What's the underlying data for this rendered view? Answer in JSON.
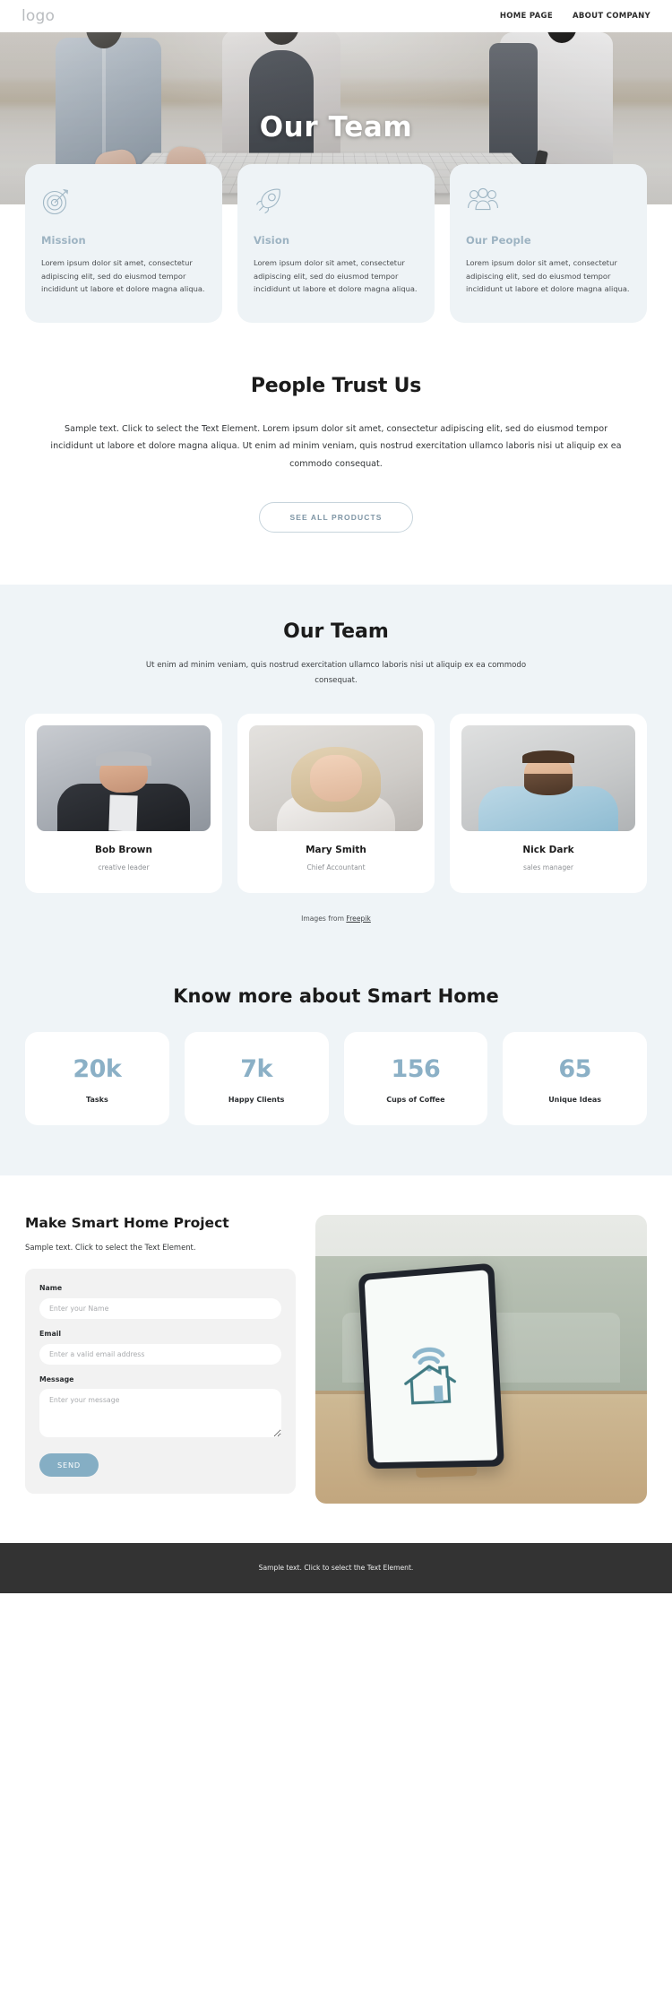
{
  "header": {
    "logo": "logo",
    "nav": [
      {
        "label": "HOME PAGE"
      },
      {
        "label": "ABOUT COMPANY"
      }
    ]
  },
  "hero": {
    "title": "Our Team"
  },
  "features": [
    {
      "icon": "target-icon",
      "title": "Mission",
      "text": "Lorem ipsum dolor sit amet, consectetur adipiscing elit, sed do eiusmod tempor incididunt ut labore et dolore magna aliqua."
    },
    {
      "icon": "rocket-icon",
      "title": "Vision",
      "text": "Lorem ipsum dolor sit amet, consectetur adipiscing elit, sed do eiusmod tempor incididunt ut labore et dolore magna aliqua."
    },
    {
      "icon": "people-group-icon",
      "title": "Our People",
      "text": "Lorem ipsum dolor sit amet, consectetur adipiscing elit, sed do eiusmod tempor incididunt ut labore et dolore magna aliqua."
    }
  ],
  "trust": {
    "title": "People Trust Us",
    "text": "Sample text. Click to select the Text Element. Lorem ipsum dolor sit amet, consectetur adipiscing elit, sed do eiusmod tempor incididunt ut labore et dolore magna aliqua. Ut enim ad minim veniam, quis nostrud exercitation ullamco laboris nisi ut aliquip ex ea commodo consequat.",
    "button_label": "SEE ALL PRODUCTS"
  },
  "team": {
    "title": "Our Team",
    "subtitle": "Ut enim ad minim veniam, quis nostrud exercitation ullamco laboris nisi ut aliquip ex ea commodo consequat.",
    "members": [
      {
        "name": "Bob Brown",
        "role": "creative leader"
      },
      {
        "name": "Mary Smith",
        "role": "Chief Accountant"
      },
      {
        "name": "Nick Dark",
        "role": "sales manager"
      }
    ],
    "credit_prefix": "Images from ",
    "credit_link": "Freepik"
  },
  "stats": {
    "title": "Know more about Smart Home",
    "items": [
      {
        "value": "20k",
        "label": "Tasks"
      },
      {
        "value": "7k",
        "label": "Happy Clients"
      },
      {
        "value": "156",
        "label": "Cups of Coffee"
      },
      {
        "value": "65",
        "label": "Unique Ideas"
      }
    ]
  },
  "contact": {
    "title": "Make Smart Home Project",
    "subtitle": "Sample text. Click to select the Text Element.",
    "fields": {
      "name_label": "Name",
      "name_placeholder": "Enter your Name",
      "email_label": "Email",
      "email_placeholder": "Enter a valid email address",
      "message_label": "Message",
      "message_placeholder": "Enter your message"
    },
    "send_label": "SEND",
    "image_alt": "smart-home-tablet-photo"
  },
  "footer": {
    "text": "Sample text. Click to select the Text Element."
  },
  "colors": {
    "accent": "#8bb0c6",
    "section_bg": "#eff4f7",
    "card_bg": "#eef3f6",
    "footer_bg": "#333333",
    "button_send": "#85aec4"
  }
}
